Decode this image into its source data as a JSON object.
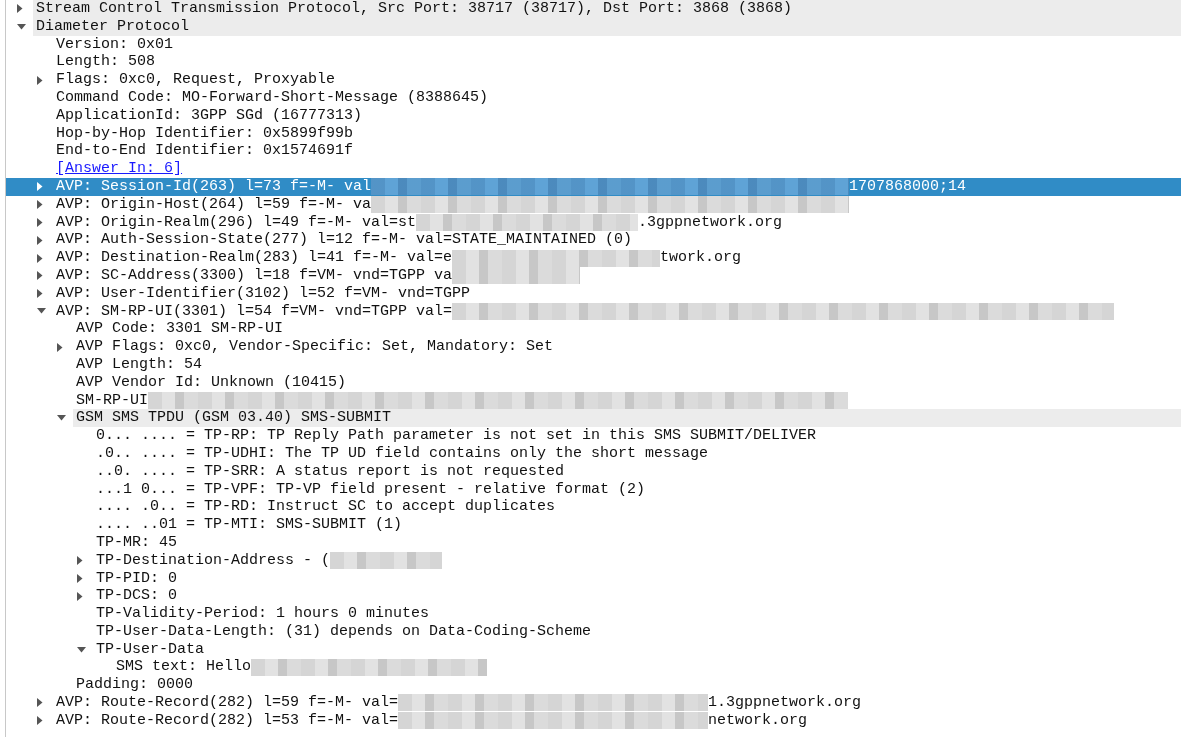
{
  "tree": [
    {
      "text": "Stream Control Transmission Protocol, Src Port: 38717 (38717), Dst Port: 3868 (3868)",
      "expanded": false,
      "selected": false,
      "highlighted": true
    },
    {
      "text": "Diameter Protocol",
      "expanded": true,
      "selected": false,
      "highlighted": true,
      "children": [
        {
          "text": "Version: 0x01",
          "selected": false,
          "highlighted": false
        },
        {
          "text": "Length: 508",
          "selected": false,
          "highlighted": false
        },
        {
          "text": "Flags: 0xc0, Request, Proxyable",
          "expanded": false,
          "selected": false,
          "highlighted": false
        },
        {
          "text": "Command Code: MO-Forward-Short-Message (8388645)",
          "selected": false,
          "highlighted": false
        },
        {
          "text": "ApplicationId: 3GPP SGd (16777313)",
          "selected": false,
          "highlighted": false
        },
        {
          "text": "Hop-by-Hop Identifier: 0x5899f99b",
          "selected": false,
          "highlighted": false
        },
        {
          "text": "End-to-End Identifier: 0x1574691f",
          "selected": false,
          "highlighted": false
        },
        {
          "text": "[Answer In: 6]",
          "kind": "link",
          "selected": false,
          "highlighted": false
        },
        {
          "text": "AVP: Session-Id(263) l=73 f=-M- val",
          "redacted": true,
          "tail": "1707868000;14",
          "expanded": false,
          "selected": true,
          "highlighted": false
        },
        {
          "text": "AVP: Origin-Host(264) l=59 f=-M- va",
          "redacted": true,
          "expanded": false,
          "selected": false,
          "highlighted": false
        },
        {
          "text": "AVP: Origin-Realm(296) l=49 f=-M- val=st",
          "redacted": true,
          "tail": ".3gppnetwork.org",
          "expanded": false,
          "selected": false,
          "highlighted": false
        },
        {
          "text": "AVP: Auth-Session-State(277) l=12 f=-M- val=STATE_MAINTAINED (0)",
          "expanded": false,
          "selected": false,
          "highlighted": false
        },
        {
          "text": "AVP: Destination-Realm(283) l=41 f=-M- val=e",
          "redacted": true,
          "tail": "twork.org",
          "expanded": false,
          "selected": false,
          "highlighted": false
        },
        {
          "text": "AVP: SC-Address(3300) l=18 f=VM- vnd=TGPP va",
          "redacted": true,
          "expanded": false,
          "selected": false,
          "highlighted": false
        },
        {
          "text": "AVP: User-Identifier(3102) l=52 f=VM- vnd=TGPP",
          "expanded": false,
          "selected": false,
          "highlighted": false
        },
        {
          "text": "AVP: SM-RP-UI(3301) l=54 f=VM- vnd=TGPP val=",
          "redacted": true,
          "expanded": true,
          "selected": false,
          "highlighted": false,
          "children": [
            {
              "text": "AVP Code: 3301 SM-RP-UI",
              "selected": false,
              "highlighted": false
            },
            {
              "text": "AVP Flags: 0xc0, Vendor-Specific: Set, Mandatory: Set",
              "expanded": false,
              "selected": false,
              "highlighted": false
            },
            {
              "text": "AVP Length: 54",
              "selected": false,
              "highlighted": false
            },
            {
              "text": "AVP Vendor Id: Unknown (10415)",
              "selected": false,
              "highlighted": false
            },
            {
              "text": "SM-RP-UI",
              "redacted": true,
              "selected": false,
              "highlighted": false
            },
            {
              "text": "GSM SMS TPDU (GSM 03.40) SMS-SUBMIT",
              "expanded": true,
              "selected": false,
              "highlighted": true,
              "children": [
                {
                  "text": "0... .... = TP-RP: TP Reply Path parameter is not set in this SMS SUBMIT/DELIVER",
                  "selected": false,
                  "highlighted": false
                },
                {
                  "text": ".0.. .... = TP-UDHI: The TP UD field contains only the short message",
                  "selected": false,
                  "highlighted": false
                },
                {
                  "text": "..0. .... = TP-SRR: A status report is not requested",
                  "selected": false,
                  "highlighted": false
                },
                {
                  "text": "...1 0... = TP-VPF: TP-VP field present - relative format (2)",
                  "selected": false,
                  "highlighted": false
                },
                {
                  "text": ".... .0.. = TP-RD: Instruct SC to accept duplicates",
                  "selected": false,
                  "highlighted": false
                },
                {
                  "text": ".... ..01 = TP-MTI: SMS-SUBMIT (1)",
                  "selected": false,
                  "highlighted": false
                },
                {
                  "text": "TP-MR: 45",
                  "selected": false,
                  "highlighted": false
                },
                {
                  "text": "TP-Destination-Address - (",
                  "redacted": true,
                  "expanded": false,
                  "selected": false,
                  "highlighted": false
                },
                {
                  "text": "TP-PID: 0",
                  "expanded": false,
                  "selected": false,
                  "highlighted": false
                },
                {
                  "text": "TP-DCS: 0",
                  "expanded": false,
                  "selected": false,
                  "highlighted": false
                },
                {
                  "text": "TP-Validity-Period: 1 hours 0 minutes",
                  "selected": false,
                  "highlighted": false
                },
                {
                  "text": "TP-User-Data-Length: (31) depends on Data-Coding-Scheme",
                  "selected": false,
                  "highlighted": false
                },
                {
                  "text": "TP-User-Data",
                  "expanded": true,
                  "selected": false,
                  "highlighted": false,
                  "children": [
                    {
                      "text": "SMS text: Hello",
                      "redacted": true,
                      "selected": false,
                      "highlighted": false
                    }
                  ]
                }
              ]
            },
            {
              "text": "Padding: 0000",
              "selected": false,
              "highlighted": false
            }
          ]
        },
        {
          "text": "AVP: Route-Record(282) l=59 f=-M- val=",
          "redacted": true,
          "tail": "1.3gppnetwork.org",
          "expanded": false,
          "selected": false,
          "highlighted": false
        },
        {
          "text": "AVP: Route-Record(282) l=53 f=-M- val=",
          "redacted": true,
          "tail": "network.org",
          "expanded": false,
          "selected": false,
          "highlighted": false
        }
      ]
    }
  ]
}
